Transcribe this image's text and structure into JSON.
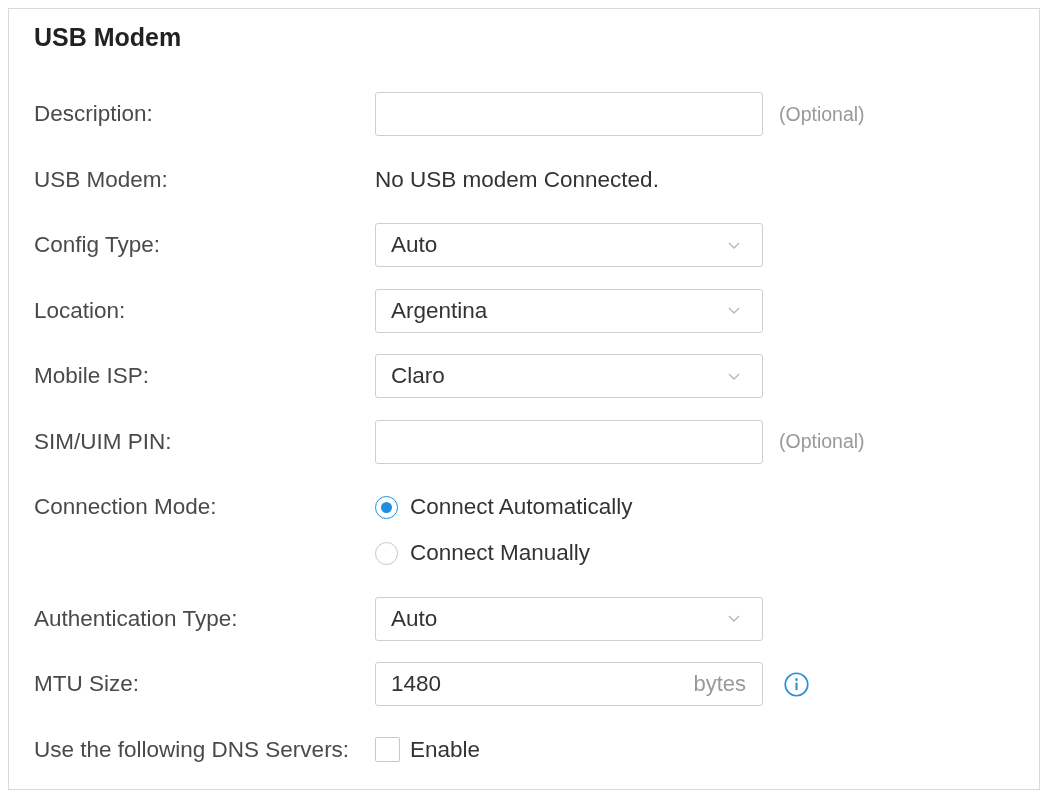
{
  "panel": {
    "title": "USB Modem"
  },
  "fields": [
    {
      "kind": "input",
      "label": "Description:",
      "note": "(Optional)"
    },
    {
      "kind": "static",
      "label": "USB Modem:",
      "text": "No USB modem Connected."
    },
    {
      "kind": "select",
      "label": "Config Type:",
      "value": "Auto"
    },
    {
      "kind": "select",
      "label": "Location:",
      "value": "Argentina"
    },
    {
      "kind": "select",
      "label": "Mobile ISP:",
      "value": "Claro"
    },
    {
      "kind": "input",
      "label": "SIM/UIM PIN:",
      "note": "(Optional)"
    },
    {
      "kind": "radio",
      "label": "Connection Mode:",
      "options": [
        {
          "label": "Connect Automatically",
          "selected": true
        },
        {
          "label": "Connect Manually",
          "selected": false
        }
      ]
    },
    {
      "kind": "select",
      "label": "Authentication Type:",
      "value": "Auto"
    },
    {
      "kind": "input",
      "label": "MTU Size:",
      "value": "1480",
      "unit": "bytes",
      "info": true
    },
    {
      "kind": "checkbox",
      "label": "Use the following DNS Servers:",
      "option": "Enable",
      "checked": false
    }
  ]
}
